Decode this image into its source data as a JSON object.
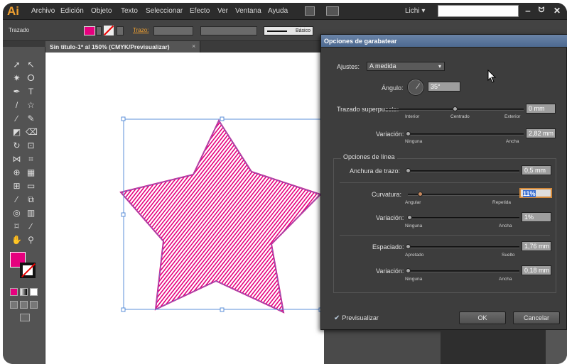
{
  "app": {
    "logo": "Ai"
  },
  "menu": [
    "Archivo",
    "Edición",
    "Objeto",
    "Texto",
    "Seleccionar",
    "Efecto",
    "Ver",
    "Ventana",
    "Ayuda"
  ],
  "workspace": "Lichi ▾",
  "window_buttons": [
    "‒",
    "ᗢ",
    "✕"
  ],
  "control_bar": {
    "label": "Trazado",
    "stroke_link": "Trazo:",
    "stroke_style": "Básico"
  },
  "document_tab": {
    "title": "Sin título-1* al 150% (CMYK/Previsualizar)",
    "close": "×"
  },
  "colors": {
    "fill": "#e6007e",
    "accent": "#f0a030",
    "dialog_title": "#4d6990"
  },
  "dialog": {
    "title": "Opciones de garabatear",
    "preset_label": "Ajustes:",
    "preset_value": "A medida",
    "angle_label": "Ángulo:",
    "angle_value": "35°",
    "overlap": {
      "label": "Trazado superpuesto:",
      "value": "0 mm",
      "left": "Interior",
      "center": "Centrado",
      "right": "Exterior",
      "position": 0.5
    },
    "overlap_variation": {
      "label": "Variación:",
      "value": "2,82 mm",
      "left": "Ninguna",
      "right": "Ancha",
      "position": 0.0
    },
    "line_options_label": "Opciones de línea",
    "stroke_width": {
      "label": "Anchura de trazo:",
      "value": "0,5 mm",
      "position": 0.0
    },
    "curviness": {
      "label": "Curvatura:",
      "value": "11%",
      "left": "Angular",
      "right": "Repetida",
      "position": 0.11
    },
    "curviness_variation": {
      "label": "Variación:",
      "value": "1%",
      "left": "Ninguna",
      "right": "Ancha",
      "position": 0.01
    },
    "spacing": {
      "label": "Espaciado:",
      "value": "1,76 mm",
      "left": "Apretado",
      "right": "Suelto",
      "position": 0.0
    },
    "spacing_variation": {
      "label": "Variación:",
      "value": "0,18 mm",
      "left": "Ninguna",
      "right": "Ancha",
      "position": 0.0
    },
    "preview_label": "Previsualizar",
    "preview_checked": true,
    "ok": "OK",
    "cancel": "Cancelar"
  }
}
